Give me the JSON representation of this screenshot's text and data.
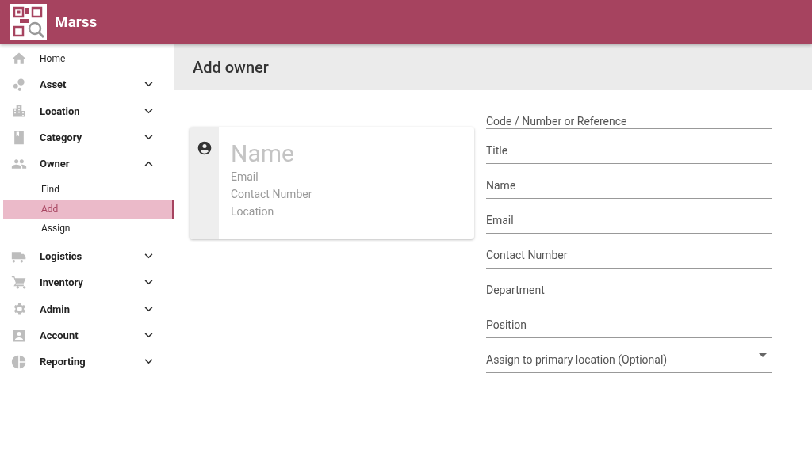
{
  "app": {
    "title": "Marss"
  },
  "sidebar": {
    "items": [
      {
        "label": "Home"
      },
      {
        "label": "Asset",
        "expanded": false
      },
      {
        "label": "Location",
        "expanded": false
      },
      {
        "label": "Category",
        "expanded": false
      },
      {
        "label": "Owner",
        "expanded": true,
        "children": [
          {
            "label": "Find",
            "selected": false
          },
          {
            "label": "Add",
            "selected": true
          },
          {
            "label": "Assign",
            "selected": false
          }
        ]
      },
      {
        "label": "Logistics",
        "expanded": false
      },
      {
        "label": "Inventory",
        "expanded": false
      },
      {
        "label": "Admin",
        "expanded": false
      },
      {
        "label": "Account",
        "expanded": false
      },
      {
        "label": "Reporting",
        "expanded": false
      }
    ]
  },
  "page": {
    "title": "Add owner"
  },
  "preview_card": {
    "name": "Name",
    "lines": [
      "Email",
      "Contact Number",
      "Location"
    ]
  },
  "form": {
    "fields": [
      {
        "placeholder": "Code / Number or Reference",
        "kind": "text"
      },
      {
        "placeholder": "Title",
        "kind": "text"
      },
      {
        "placeholder": "Name",
        "kind": "text"
      },
      {
        "placeholder": "Email",
        "kind": "text"
      },
      {
        "placeholder": "Contact Number",
        "kind": "text"
      },
      {
        "placeholder": "Department",
        "kind": "text"
      },
      {
        "placeholder": "Position",
        "kind": "text"
      },
      {
        "placeholder": "Assign to primary location (Optional)",
        "kind": "select"
      }
    ]
  }
}
